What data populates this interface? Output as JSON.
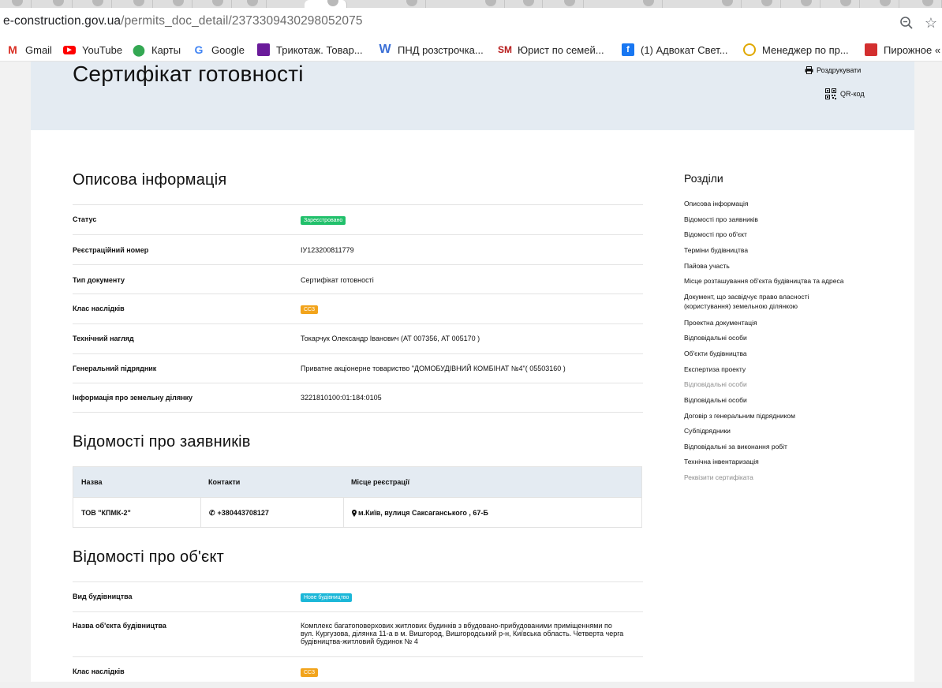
{
  "browser": {
    "url_host": "e-construction.gov.ua",
    "url_path": "/permits_doc_detail/2373309430298052075",
    "bookmarks": [
      {
        "label": "Gmail",
        "icon": "gmail-icon",
        "color": "#d93025"
      },
      {
        "label": "YouTube",
        "icon": "youtube-icon",
        "color": "#ff0000"
      },
      {
        "label": "Карты",
        "icon": "maps-icon",
        "color": "#34a853"
      },
      {
        "label": "Google",
        "icon": "google-icon",
        "color": "#4285f4"
      },
      {
        "label": "Трикотаж. Товар...",
        "icon": "purple-square-icon",
        "color": "#6a1b9a"
      },
      {
        "label": "ПНД розстрочка...",
        "icon": "w-letter-icon",
        "color": "#3b6fd6"
      },
      {
        "label": "Юрист по семей...",
        "icon": "sm-logo-icon",
        "color": "#b71c1c"
      },
      {
        "label": "(1) Адвокат Свет...",
        "icon": "facebook-icon",
        "color": "#1877f2"
      },
      {
        "label": "Менеджер по пр...",
        "icon": "hh-logo-icon",
        "color": "#e0a800"
      },
      {
        "label": "Пирожное «",
        "icon": "red-logo-icon",
        "color": "#d32f2f"
      }
    ]
  },
  "header": {
    "title": "Сертифікат готовності",
    "print_label": "Роздрукувати",
    "qr_label": "QR-код"
  },
  "descriptive": {
    "title": "Описова інформація",
    "rows": [
      {
        "label": "Статус",
        "value": "Зареєстровано",
        "badge": "green"
      },
      {
        "label": "Реєстраційний номер",
        "value": "ІУ123200811779"
      },
      {
        "label": "Тип документу",
        "value": "Сертифікат готовності"
      },
      {
        "label": "Клас наслідків",
        "value": "СС3",
        "badge": "orange"
      },
      {
        "label": "Технічний нагляд",
        "value": "Токарчук Олександр Іванович (АТ 007356, АТ 005170 )"
      },
      {
        "label": "Генеральний підрядник",
        "value": "Приватне акціонерне товариство \"ДОМОБУДІВНИЙ КОМБІНАТ №4\"( 05503160 )"
      },
      {
        "label": "Інформація про земельну ділянку",
        "value": "3221810100:01:184:0105"
      }
    ]
  },
  "applicants": {
    "title": "Відомості про заявників",
    "columns": [
      "Назва",
      "Контакти",
      "Місце реєстрації"
    ],
    "rows": [
      {
        "name": "ТОВ \"КПМК-2\"",
        "phone": "+380443708127",
        "address": "м.Київ, вулиця Саксаганського , 67-Б"
      }
    ]
  },
  "object": {
    "title": "Відомості про об'єкт",
    "rows": [
      {
        "label": "Вид будівництва",
        "value": "Нове будівництво",
        "badge": "cyan"
      },
      {
        "label": "Назва об'єкта будівництва",
        "value": "Комплекс багатоповерхових житлових будинків з вбудовано-прибудованими приміщеннями по вул. Кургузова, ділянка 11-а в м. Вишгород, Вишгородський р-н, Київська область. Четверта черга будівництва-житловий будинок № 4"
      },
      {
        "label": "Клас наслідків",
        "value": "СС3",
        "badge": "orange"
      }
    ]
  },
  "sidebar": {
    "title": "Розділи",
    "items": [
      {
        "label": "Описова інформація",
        "muted": false
      },
      {
        "label": "Відомості про заявників",
        "muted": false
      },
      {
        "label": "Відомості про об'єкт",
        "muted": false
      },
      {
        "label": "Терміни будівництва",
        "muted": false
      },
      {
        "label": "Пайова участь",
        "muted": false
      },
      {
        "label": "Місце розташування об'єкта будівництва та адреса",
        "muted": false
      },
      {
        "label": "Документ, що засвідчує право власності (користування) земельною ділянкою",
        "muted": false
      },
      {
        "label": "Проектна документація",
        "muted": false
      },
      {
        "label": "Відповідальні особи",
        "muted": false
      },
      {
        "label": "Об'єкти будівництва",
        "muted": false
      },
      {
        "label": "Експертиза проекту",
        "muted": false
      },
      {
        "label": "Відповідальні особи",
        "muted": true
      },
      {
        "label": "Відповідальні особи",
        "muted": false
      },
      {
        "label": "Договір з генеральним підрядником",
        "muted": false
      },
      {
        "label": "Субпідрядники",
        "muted": false
      },
      {
        "label": "Відповідальні за виконання робіт",
        "muted": false
      },
      {
        "label": "Технічна інвентаризація",
        "muted": false
      },
      {
        "label": "Реквізити сертифіката",
        "muted": true
      }
    ]
  }
}
